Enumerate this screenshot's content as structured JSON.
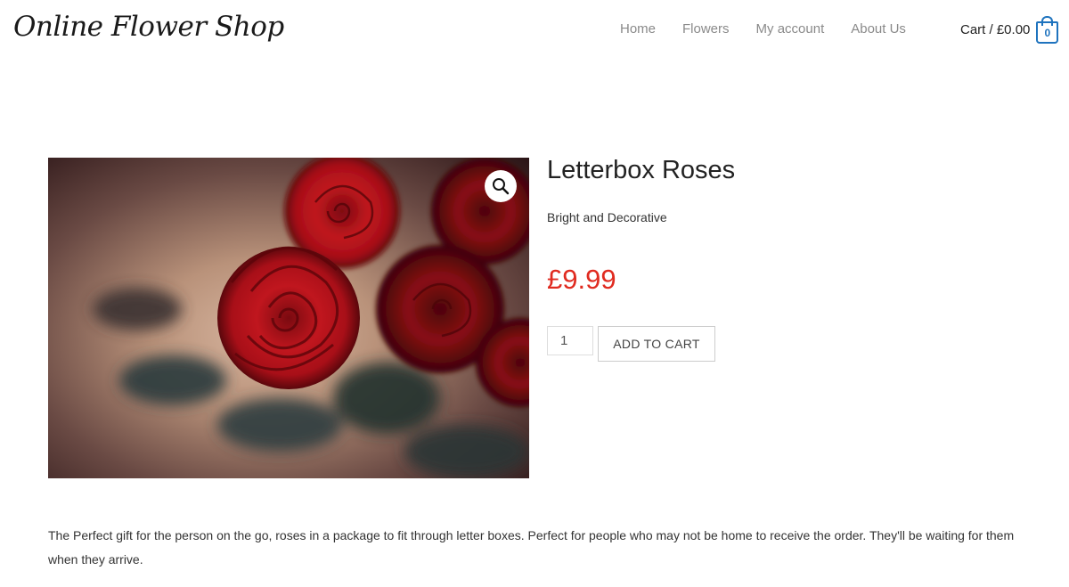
{
  "header": {
    "logo": "Online Flower Shop",
    "nav": [
      "Home",
      "Flowers",
      "My account",
      "About Us"
    ],
    "cart": {
      "label": "Cart / £0.00",
      "count": "0"
    }
  },
  "product": {
    "title": "Letterbox Roses",
    "short_description": "Bright and Decorative",
    "price": "£9.99",
    "quantity": "1",
    "add_to_cart_label": "ADD TO CART",
    "description": "The Perfect gift for the person on the go, roses in a package to fit through letter boxes.  Perfect for people who may not be home to receive the order.  They'll be waiting for them when they arrive."
  },
  "icons": {
    "zoom": "magnifier-icon",
    "cart": "shopping-bag-icon"
  },
  "colors": {
    "price": "#e02b20",
    "cart_accent": "#1e73be"
  }
}
